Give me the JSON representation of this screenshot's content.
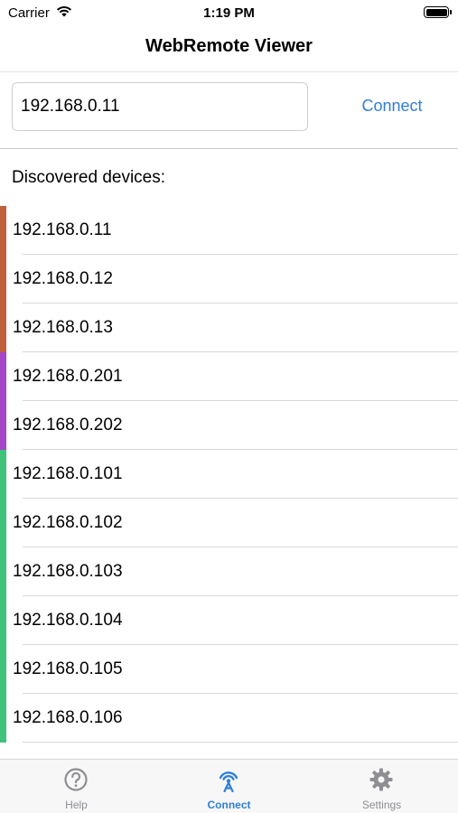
{
  "status_bar": {
    "carrier": "Carrier",
    "time": "1:19 PM"
  },
  "nav": {
    "title": "WebRemote Viewer"
  },
  "connect_form": {
    "ip_value": "192.168.0.11",
    "connect_label": "Connect"
  },
  "devices_section": {
    "label": "Discovered devices:",
    "items": [
      {
        "ip": "192.168.0.11",
        "color": "#c0603a"
      },
      {
        "ip": "192.168.0.12",
        "color": "#c0603a"
      },
      {
        "ip": "192.168.0.13",
        "color": "#c0603a"
      },
      {
        "ip": "192.168.0.201",
        "color": "#a545c8"
      },
      {
        "ip": "192.168.0.202",
        "color": "#a545c8"
      },
      {
        "ip": "192.168.0.101",
        "color": "#3fc27a"
      },
      {
        "ip": "192.168.0.102",
        "color": "#3fc27a"
      },
      {
        "ip": "192.168.0.103",
        "color": "#3fc27a"
      },
      {
        "ip": "192.168.0.104",
        "color": "#3fc27a"
      },
      {
        "ip": "192.168.0.105",
        "color": "#3fc27a"
      },
      {
        "ip": "192.168.0.106",
        "color": "#3fc27a"
      }
    ]
  },
  "tab_bar": {
    "tabs": [
      {
        "label": "Help",
        "icon": "question-circle-icon",
        "active": false
      },
      {
        "label": "Connect",
        "icon": "antenna-icon",
        "active": true
      },
      {
        "label": "Settings",
        "icon": "gear-icon",
        "active": false
      }
    ]
  },
  "colors": {
    "accent": "#2f7fd6",
    "inactive": "#8e8e93"
  }
}
